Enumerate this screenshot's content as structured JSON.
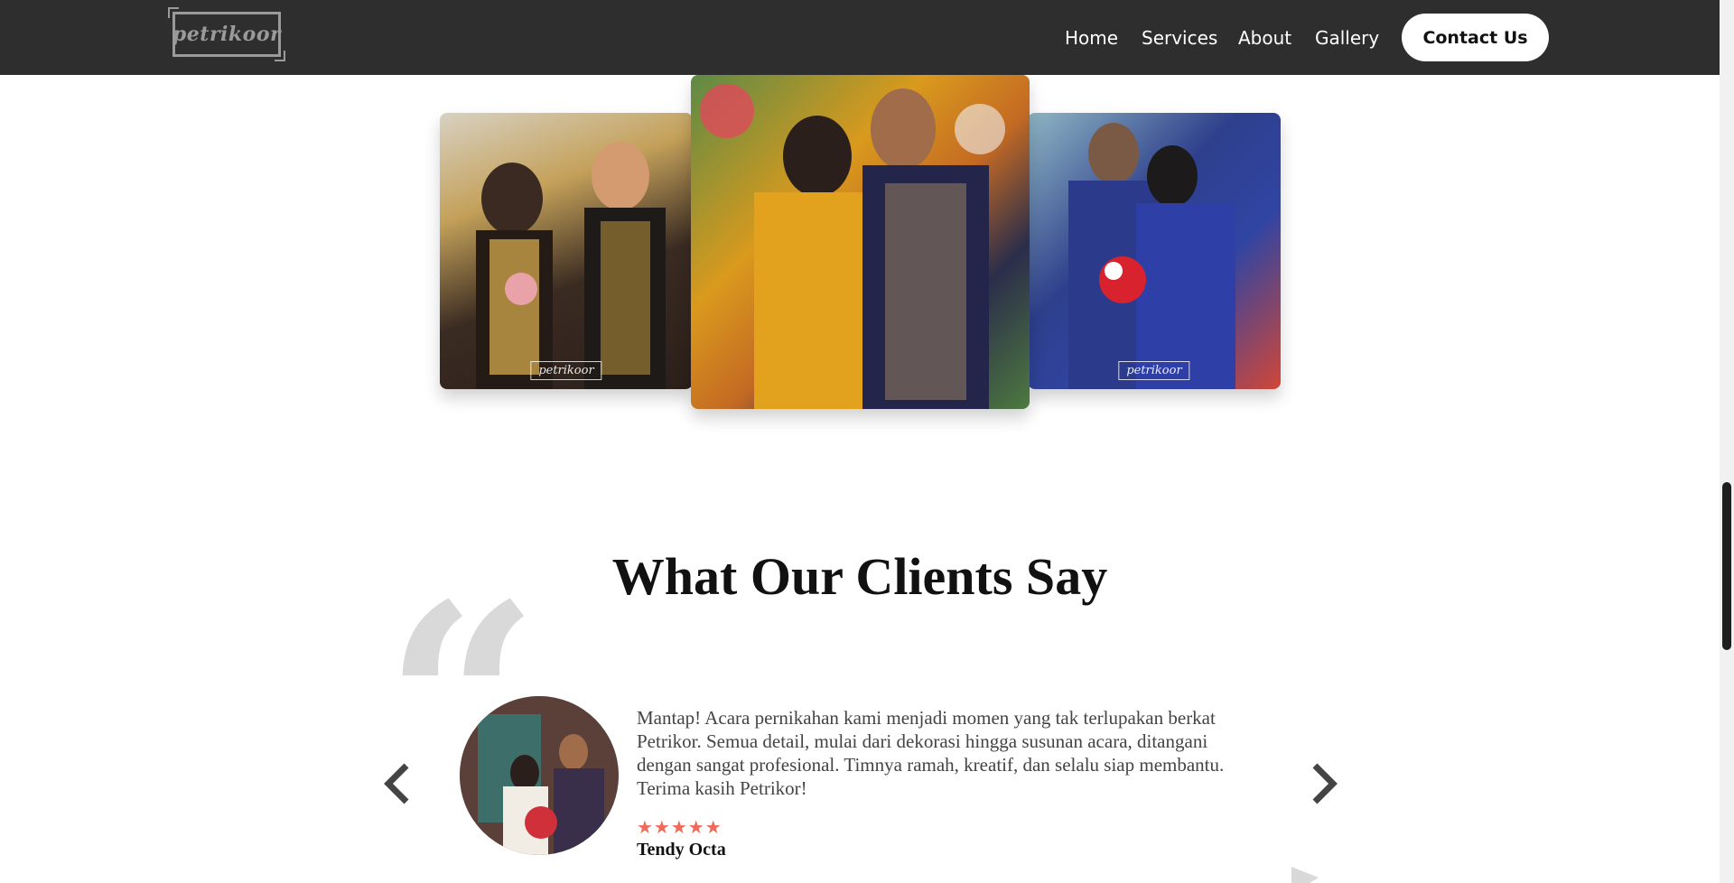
{
  "nav": {
    "logo_text": "petrikoor",
    "links": [
      "Home",
      "Services",
      "About",
      "Gallery"
    ],
    "contact_label": "Contact Us"
  },
  "gallery": {
    "watermark": "petrikoor"
  },
  "testimonials": {
    "title": "What Our Clients Say",
    "text": "Mantap! Acara pernikahan kami menjadi momen yang tak terlupakan berkat Petrikor. Semua detail, mulai dari dekorasi hingga susunan acara, ditangani dengan sangat profesional. Timnya ramah, kreatif, dan selalu siap membantu. Terima kasih Petrikor!",
    "stars": "★★★★★",
    "rating": 5,
    "name": "Tendy Octa"
  },
  "colors": {
    "header_bg": "#2e2e2e",
    "star": "#f06a5a",
    "quote_mark": "#d9d9d9"
  },
  "icons": {
    "prev": "chevron-left-icon",
    "next": "chevron-right-icon"
  }
}
